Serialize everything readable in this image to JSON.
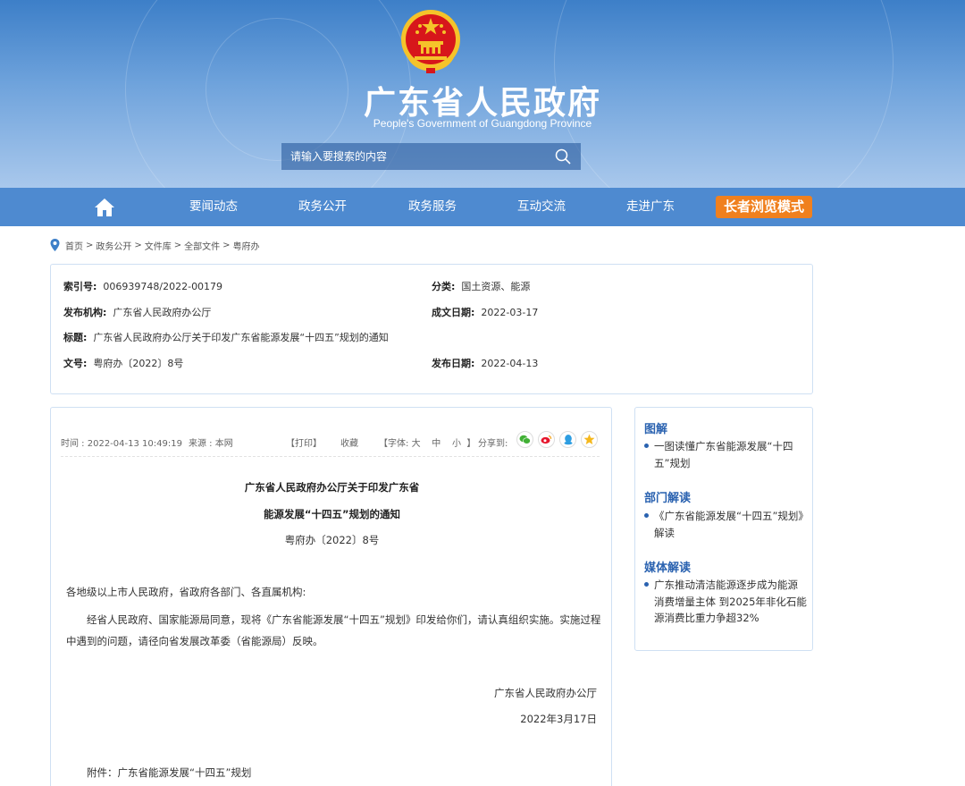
{
  "header": {
    "title": "广东省人民政府",
    "subtitle": "People's Government of Guangdong Province",
    "search_placeholder": "请输入要搜索的内容"
  },
  "nav": {
    "items": [
      "要闻动态",
      "政务公开",
      "政务服务",
      "互动交流",
      "走进广东"
    ],
    "elder_mode": "长者浏览模式"
  },
  "breadcrumb": [
    "首页",
    "政务公开",
    "文件库",
    "全部文件",
    "粤府办"
  ],
  "meta": {
    "index_no_label": "索引号:",
    "index_no": "006939748/2022-00179",
    "category_label": "分类:",
    "category": "国土资源、能源",
    "publisher_label": "发布机构:",
    "publisher": "广东省人民政府办公厅",
    "created_label": "成文日期:",
    "created": "2022-03-17",
    "title_label": "标题:",
    "title": "广东省人民政府办公厅关于印发广东省能源发展“十四五”规划的通知",
    "doc_no_label": "文号:",
    "doc_no": "粤府办〔2022〕8号",
    "published_label": "发布日期:",
    "published": "2022-04-13"
  },
  "toolbar": {
    "time": "时间 : 2022-04-13 10:49:19",
    "source": "来源 : 本网",
    "print": "【打印】",
    "favorite": "收藏",
    "font_prefix": "【字体:",
    "font_large": "大",
    "font_medium": "中",
    "font_small": "小",
    "font_suffix": "】",
    "share": "分享到:",
    "share_icons": [
      "wechat-icon",
      "weibo-icon",
      "qq-icon",
      "qzone-icon"
    ]
  },
  "document": {
    "title_line1": "广东省人民政府办公厅关于印发广东省",
    "title_line2": "能源发展“十四五”规划的通知",
    "number": "粤府办〔2022〕8号",
    "salutation": "各地级以上市人民政府，省政府各部门、各直属机构:",
    "body": "经省人民政府、国家能源局同意，现将《广东省能源发展“十四五”规划》印发给你们，请认真组织实施。实施过程中遇到的问题，请径向省发展改革委（省能源局）反映。",
    "signature": "广东省人民政府办公厅",
    "date": "2022年3月17日",
    "attachment": "附件：广东省能源发展“十四五”规划"
  },
  "sidebar": {
    "sections": [
      {
        "heading": "图解",
        "link": "一图读懂广东省能源发展“十四五”规划"
      },
      {
        "heading": "部门解读",
        "link": "《广东省能源发展“十四五”规划》解读"
      },
      {
        "heading": "媒体解读",
        "link": "广东推动清洁能源逐步成为能源消费增量主体 到2025年非化石能源消费比重力争超32%"
      }
    ]
  },
  "colors": {
    "header_blue": "#3d7fc8",
    "nav_blue": "#4e8ad0",
    "elder_orange": "#f0801e",
    "link_blue": "#2a62b0",
    "emblem_red": "#d7161b",
    "emblem_gold": "#f5c32a"
  }
}
